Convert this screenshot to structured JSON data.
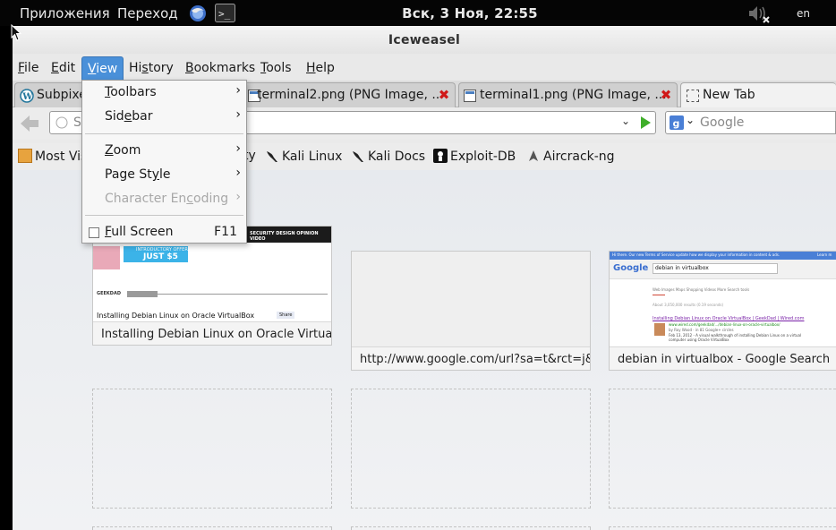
{
  "panel": {
    "applications": "Приложения",
    "places": "Переход",
    "clock": "Вск,  3 Ноя, 22:55",
    "lang": "en"
  },
  "window": {
    "title": "Iceweasel"
  },
  "menubar": {
    "items": [
      "File",
      "Edit",
      "View",
      "History",
      "Bookmarks",
      "Tools",
      "Help"
    ]
  },
  "tabs": [
    {
      "label": "Subpixe"
    },
    {
      "label": "terminal2.png (PNG Image, ..."
    },
    {
      "label": "terminal1.png (PNG Image, ..."
    },
    {
      "label": "New Tab"
    }
  ],
  "navbar": {
    "url_placeholder": "S",
    "search_placeholder": "Google"
  },
  "bookmarks": [
    {
      "label": "Most Vis"
    },
    {
      "label": "ty"
    },
    {
      "label": "Kali Linux"
    },
    {
      "label": "Kali Docs"
    },
    {
      "label": "Exploit-DB"
    },
    {
      "label": "Aircrack-ng"
    }
  ],
  "view_menu": {
    "toolbars": "Toolbars",
    "sidebar": "Sidebar",
    "zoom": "Zoom",
    "page_style": "Page Style",
    "char_encoding": "Character Encoding",
    "full_screen": "Full Screen",
    "full_screen_shortcut": "F11"
  },
  "tiles": [
    {
      "caption": "Installing Debian Linux on Oracle VirtualB..."
    },
    {
      "caption": "http://www.google.com/url?sa=t&rct=j&q..."
    },
    {
      "caption": "debian in virtualbox - Google Search"
    }
  ],
  "thumb1": {
    "menu": "SECURITY  DESIGN  OPINION  VIDEO",
    "offer": "INTRODUCTORY OFFER",
    "price": "JUST $5",
    "brand": "GEEKDAD",
    "headline": "Installing Debian Linux on Oracle VirtualBox",
    "share": "Share"
  },
  "thumb3": {
    "notice": "Hi there. Our new Terms of Service update how we display your information in content & ads.",
    "learn": "Learn m",
    "logo": "Google",
    "query": "debian in virtualbox",
    "tabs": "Web   Images   Maps   Shopping   Videos   More   Search tools",
    "stats": "About 3,050,000 results (0.19 seconds)",
    "result_title": "Installing Debian Linux on Oracle VirtualBox | GeekDad | Wired.com",
    "result_url": "www.wired.com/geekdad/.../debian-linux-on-oracle-virtualbox/",
    "result_snip": "by Roy Wood · in 81 Google+ circles",
    "result_date": "Feb 13, 2012 - A visual walkthrough of installing Debian Linux on a virtual computer using Oracle VirtualBox"
  }
}
